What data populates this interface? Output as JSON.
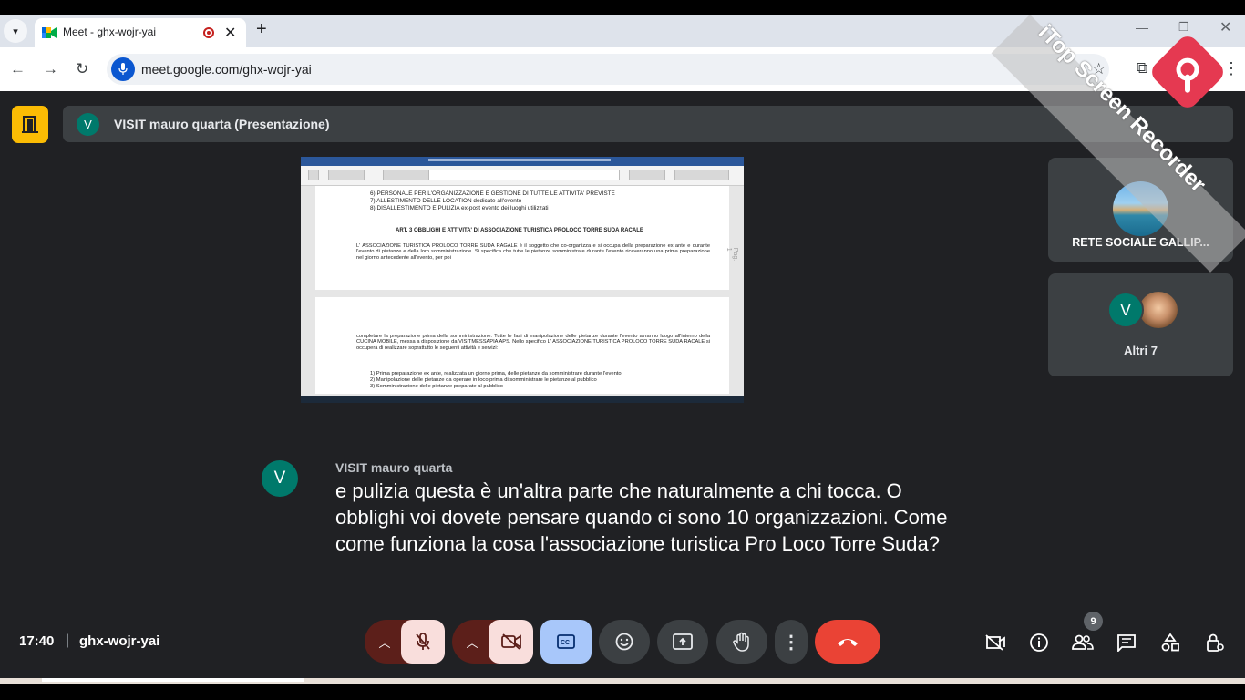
{
  "browser": {
    "tab_title": "Meet - ghx-wojr-yai",
    "new_tab_label": "+",
    "close_tab_label": "✕",
    "url": "meet.google.com/ghx-wojr-yai",
    "window_controls": {
      "minimize": "—",
      "restore": "❐",
      "close": "✕"
    },
    "icons": [
      "tab-search-icon",
      "meet-favicon",
      "recording-icon",
      "back-icon",
      "forward-icon",
      "reload-icon",
      "mic-permission-icon",
      "bookmark-star-icon",
      "extensions-icon",
      "menu-icon"
    ]
  },
  "watermark": {
    "text": "iTop Screen Recorder"
  },
  "meet": {
    "presenter_avatar": "V",
    "presenter_title": "VISIT mauro quarta (Presentazione)",
    "shared_doc": {
      "list_top": [
        "6)   PERSONALE PER L'ORGANIZZAZIONE E GESTIONE DI TUTTE LE ATTIVITA' PREVISTE",
        "7)   ALLESTIMENTO DELLE LOCATION dedicate all'evento",
        "8)   DISALLESTIMENTO E PULIZIA ex-post evento dei luoghi utilizzati"
      ],
      "heading": "ART. 3 OBBLIGHI E ATTIVITA' DI ASSOCIAZIONE TURISTICA PROLOCO TORRE SUDA RACALE",
      "paragraph1": "L' ASSOCIAZIONE TURISTICA PROLOCO TORRE SUDA RAGALE è il soggetto che co-organizza e si occupa della preparazione ex ante e durante l'evento di pietanze e della loro somministrazione. Si specifica che tutte le pietanze somministrate durante l'evento riceveranno una prima preparazione nel giorno antecedente all'evento, per poi",
      "page_label": "Pag. 1",
      "paragraph2": "completare la preparazione prima della somministrazione. Tutte le fasi di manipolazione delle pietanze durante l'evento avranno luogo all'interno della CUCINA MOBILE, messa a disposizione da VISITMESSAPIA APS. Nello specifico L' ASSOCIAZIONE TURISTICA PROLOCO TORRE SUDA RACALE si occuperà di realizzare soprattutto le seguenti attività e servizi:",
      "list_bottom": [
        "1)   Prima preparazione ex ante, realizzata un giorno prima, delle pietanze da somministrare durante l'evento",
        "2)   Manipolazione delle pietanze da operare in loco prima di somministrare le pietanze al pubblico",
        "3)   Somministrazione delle pietanze preparate al pubblico"
      ]
    },
    "tiles": [
      {
        "name": "RETE SOCIALE GALLIP..."
      },
      {
        "avatar": "V",
        "label": "Altri 7"
      }
    ],
    "caption": {
      "avatar": "V",
      "speaker": "VISIT mauro quarta",
      "text": "e pulizia questa è un'altra parte che naturalmente a chi tocca. O obblighi voi dovete pensare quando ci sono 10 organizzazioni. Come come funziona la cosa l'associazione turistica Pro Loco Torre Suda?"
    },
    "bottom_bar": {
      "time": "17:40",
      "separator": "|",
      "meeting_code": "ghx-wojr-yai",
      "people_count": "9"
    },
    "colors": {
      "background": "#202124",
      "accent_yellow": "#fbbc04",
      "leave_red": "#ea4335",
      "caption_blue": "#a8c7fa",
      "teal_avatar": "#00796b"
    }
  }
}
